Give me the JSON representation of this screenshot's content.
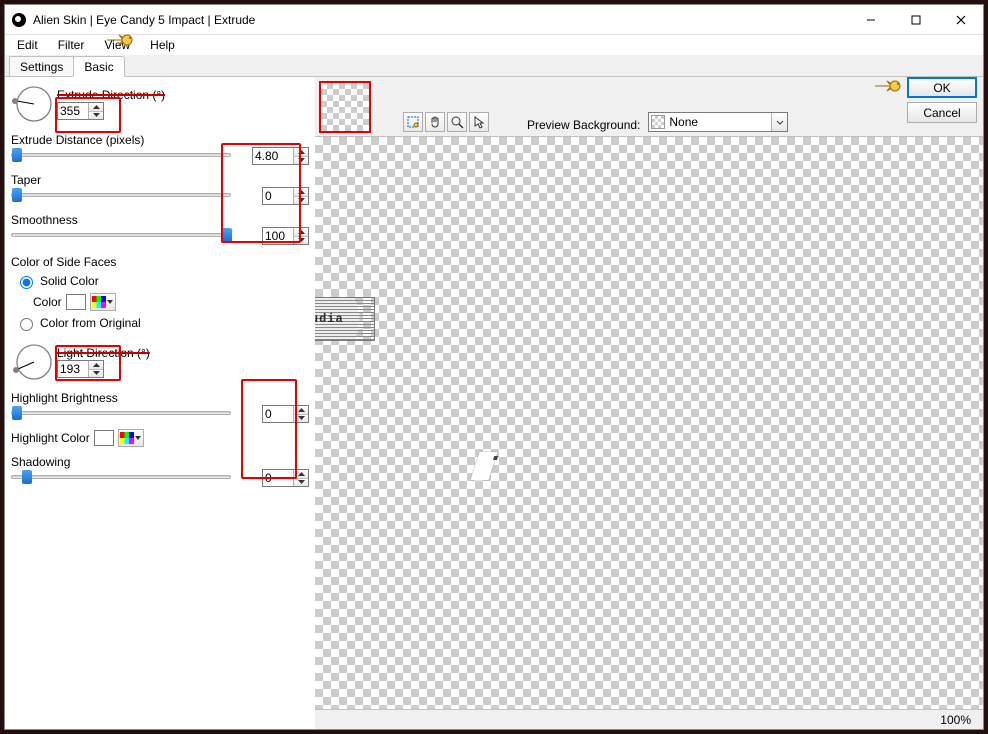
{
  "window": {
    "title": "Alien Skin | Eye Candy 5 Impact | Extrude"
  },
  "menu": {
    "edit": "Edit",
    "filter": "Filter",
    "view": "View",
    "help": "Help"
  },
  "tabs": {
    "settings": "Settings",
    "basic": "Basic"
  },
  "panel": {
    "extrude_direction_label": "Extrude Direction (°)",
    "extrude_direction_value": "355",
    "extrude_distance_label": "Extrude Distance (pixels)",
    "extrude_distance_value": "4.80",
    "taper_label": "Taper",
    "taper_value": "0",
    "smoothness_label": "Smoothness",
    "smoothness_value": "100",
    "side_faces_label": "Color of Side Faces",
    "solid_color_label": "Solid Color",
    "color_label": "Color",
    "color_from_original_label": "Color from Original",
    "light_direction_label": "Light Direction (°)",
    "light_direction_value": "193",
    "highlight_brightness_label": "Highlight Brightness",
    "highlight_brightness_value": "0",
    "highlight_color_label": "Highlight Color",
    "shadowing_label": "Shadowing",
    "shadowing_value": "0"
  },
  "toolbar": {
    "preview_bg_label": "Preview Background:",
    "preview_bg_value": "None",
    "ok": "OK",
    "cancel": "Cancel"
  },
  "status": {
    "zoom": "100%"
  },
  "watermark": "claudia"
}
